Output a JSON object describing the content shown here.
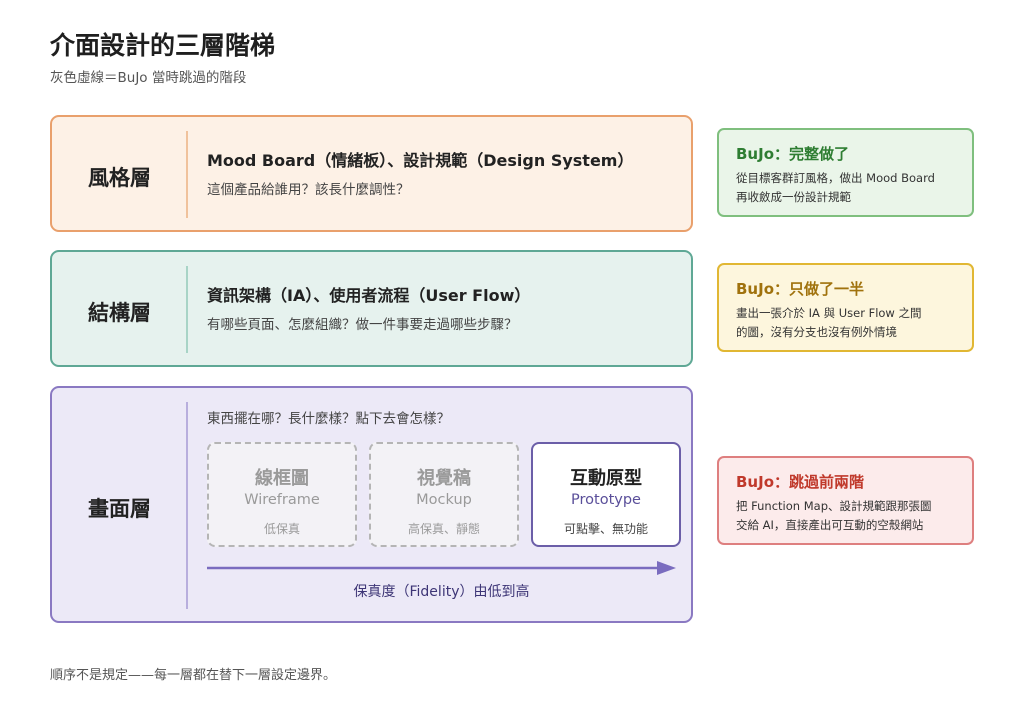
{
  "title": "介面設計的三層階梯",
  "subtitle": "灰色虛線＝BuJo 當時跳過的階段",
  "footer": "順序不是規定——每一層都在替下一層設定邊界。",
  "layers": {
    "style": {
      "name": "風格層",
      "heading": "Mood Board（情緒板）、設計規範（Design System）",
      "question": "這個產品給誰用？該長什麼調性？"
    },
    "structure": {
      "name": "結構層",
      "heading": "資訊架構（IA）、使用者流程（User Flow）",
      "question": "有哪些頁面、怎麼組織？做一件事要走過哪些步驟？"
    },
    "screen": {
      "name": "畫面層",
      "question": "東西擺在哪？長什麼樣？點下去會怎樣？",
      "stages": [
        {
          "title": "線框圖",
          "en": "Wireframe",
          "note": "低保真",
          "status": "skipped"
        },
        {
          "title": "視覺稿",
          "en": "Mockup",
          "note": "高保真、靜態",
          "status": "skipped"
        },
        {
          "title": "互動原型",
          "en": "Prototype",
          "note": "可點擊、無功能",
          "status": "done"
        }
      ],
      "fidelity_label": "保真度（Fidelity）由低到高"
    }
  },
  "notes": {
    "style": {
      "title": "BuJo：完整做了",
      "lines": [
        "從目標客群訂風格，做出 Mood Board",
        "再收斂成一份設計規範"
      ]
    },
    "structure": {
      "title": "BuJo：只做了一半",
      "lines": [
        "畫出一張介於 IA 與 User Flow 之間",
        "的圖，沒有分支也沒有例外情境"
      ]
    },
    "screen": {
      "title": "BuJo：跳過前兩階",
      "lines": [
        "把 Function Map、設計規範跟那張圖",
        "交給 AI，直接產出可互動的空殼網站"
      ]
    }
  },
  "colors": {
    "style_accent": "#e9a06c",
    "structure_accent": "#5fa895",
    "screen_accent": "#8a79c2",
    "note_done": "#2e7d32",
    "note_half": "#a0720d",
    "note_skipped": "#c0392b"
  }
}
